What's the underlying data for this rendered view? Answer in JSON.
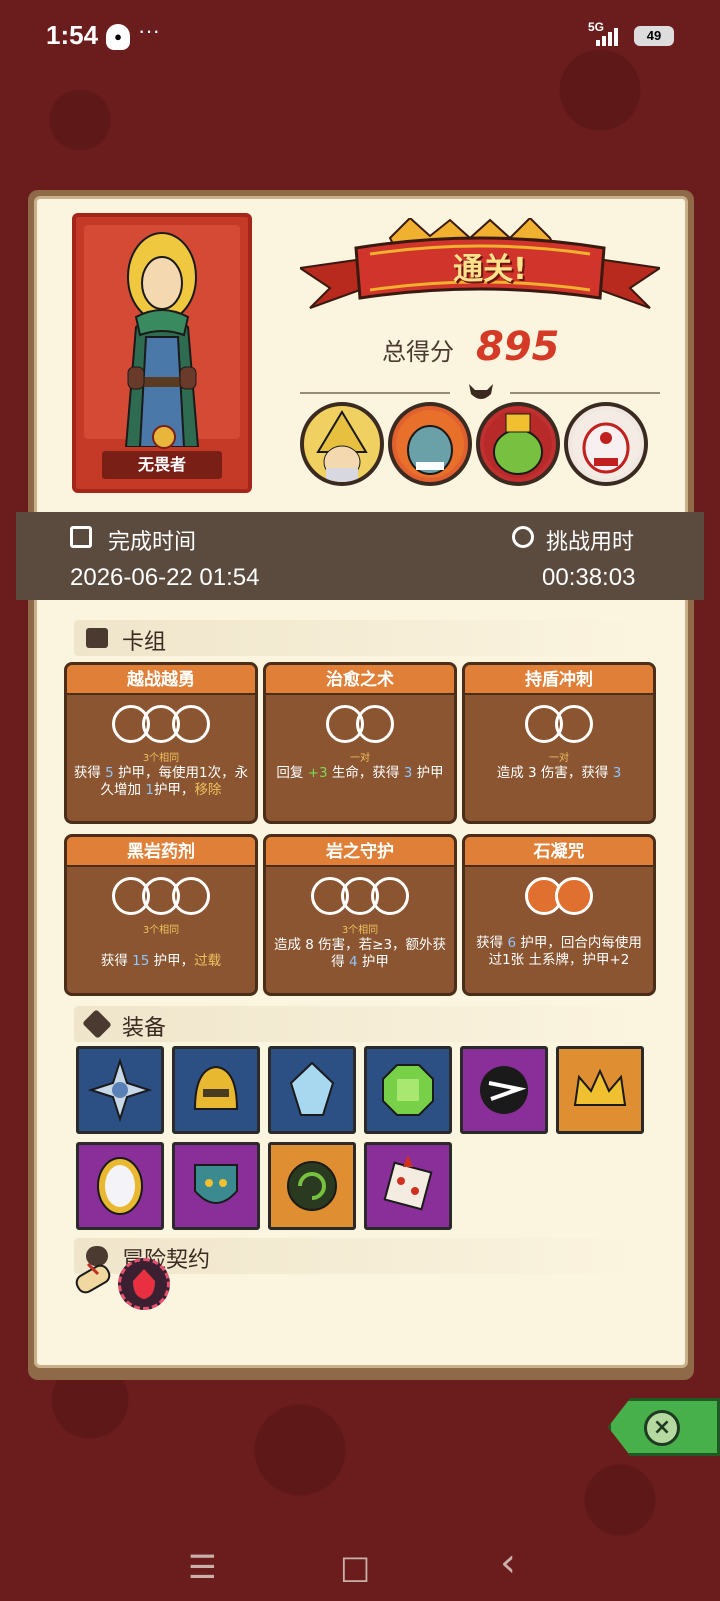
{
  "status_bar": {
    "time": "1:54",
    "dots": "···",
    "network": "5G",
    "battery": "49"
  },
  "hero": {
    "name": "无畏者"
  },
  "result": {
    "banner": "通关!",
    "score_label": "总得分",
    "score": "895"
  },
  "bosses": [
    "wizard-boss",
    "troll-boss",
    "goblin-king-boss",
    "demon-mask-boss"
  ],
  "time_info": {
    "completion_label": "完成时间",
    "completion_value": "2026-06-22 01:54",
    "duration_label": "挑战用时",
    "duration_value": "00:38:03"
  },
  "sections": {
    "deck": "卡组",
    "equipment": "装备",
    "contract": "冒险契约"
  },
  "cards": [
    {
      "title": "越战越勇",
      "count": 3,
      "sub": "3个相同",
      "desc_a": "获得 ",
      "v1": "5",
      "desc_b": " 护甲，每使用1次，永久增加 ",
      "v2": "1",
      "desc_c": "护甲，",
      "tail": "移除"
    },
    {
      "title": "治愈之术",
      "count": 2,
      "sub": "一对",
      "desc_a": "回复 ",
      "v1": "+3",
      "desc_b": " 生命，获得 ",
      "v2": "3",
      "desc_c": " 护甲",
      "tail": ""
    },
    {
      "title": "持盾冲刺",
      "count": 2,
      "sub": "一对",
      "desc_a": "造成 ",
      "v1": "3",
      "desc_b": " 伤害，获得 ",
      "v2": "3",
      "desc_c": "",
      "tail": ""
    },
    {
      "title": "黑岩药剂",
      "count": 3,
      "sub": "3个相同",
      "desc_a": "获得 ",
      "v1": "15",
      "desc_b": " 护甲，",
      "v2": "",
      "desc_c": "",
      "tail": "过载"
    },
    {
      "title": "岩之守护",
      "count": 3,
      "sub": "3个相同",
      "desc_a": "造成 ",
      "v1": "8",
      "desc_b": " 伤害，若",
      "v2": "≥3，额外获得 ",
      "desc_c": "4",
      "tail": " 护甲"
    },
    {
      "title": "石凝咒",
      "count": 2,
      "sub": "",
      "desc_a": "获得 ",
      "v1": "6",
      "desc_b": " 护甲，回合内每使用过1张 ",
      "v2": "土系牌，",
      "desc_c": "护甲+2",
      "tail": ""
    }
  ],
  "equipment": [
    {
      "name": "snowflake-badge",
      "color": "blue"
    },
    {
      "name": "golden-helmet",
      "color": "blue"
    },
    {
      "name": "blue-crystal",
      "color": "blue"
    },
    {
      "name": "green-gem",
      "color": "blue"
    },
    {
      "name": "shadow-rune",
      "color": "purple"
    },
    {
      "name": "gold-crown",
      "color": "orange"
    },
    {
      "name": "magic-mirror",
      "color": "purple"
    },
    {
      "name": "demon-shield",
      "color": "purple"
    },
    {
      "name": "ammonite-fossil",
      "color": "orange"
    },
    {
      "name": "spiked-dice",
      "color": "purple"
    }
  ],
  "contracts": [
    "scroll-icon",
    "red-demon-icon"
  ],
  "nav": {
    "menu": "☰",
    "home": "□",
    "back": "‹"
  }
}
